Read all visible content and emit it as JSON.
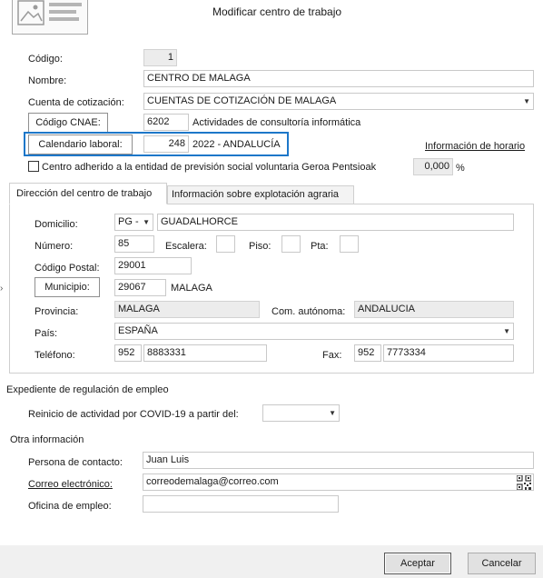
{
  "window": {
    "title": "Modificar centro de trabajo"
  },
  "main": {
    "codigo": {
      "label": "Código:",
      "value": "1"
    },
    "nombre": {
      "label": "Nombre:",
      "value": "CENTRO DE MALAGA"
    },
    "cuenta": {
      "label": "Cuenta de cotización:",
      "value": "CUENTAS DE COTIZACIÓN DE MALAGA"
    },
    "cnae": {
      "button": "Código CNAE:",
      "code": "6202",
      "description": "Actividades de consultoría informática"
    },
    "calendario": {
      "button": "Calendario laboral:",
      "code": "248",
      "description": "2022 - ANDALUCÍA"
    },
    "info_horario": "Información de horario",
    "geroa": {
      "label": "Centro adherido a la entidad de previsión social voluntaria Geroa Pentsioak",
      "value": "0,000",
      "unit": "%"
    }
  },
  "tabs": [
    {
      "label": "Dirección del centro de trabajo"
    },
    {
      "label": "Información sobre explotación agraria"
    }
  ],
  "direccion": {
    "domicilio": {
      "label": "Domicilio:",
      "type": "PG -",
      "value": "GUADALHORCE"
    },
    "numero": {
      "label": "Número:",
      "value": "85"
    },
    "escalera": {
      "label": "Escalera:",
      "value": ""
    },
    "piso": {
      "label": "Piso:",
      "value": ""
    },
    "pta": {
      "label": "Pta:",
      "value": ""
    },
    "codigo_postal": {
      "label": "Código Postal:",
      "value": "29001"
    },
    "municipio": {
      "button": "Municipio:",
      "code": "29067",
      "name": "MALAGA"
    },
    "provincia": {
      "label": "Provincia:",
      "value": "MALAGA"
    },
    "com_autonoma": {
      "label": "Com. autónoma:",
      "value": "ANDALUCIA"
    },
    "pais": {
      "label": "País:",
      "value": "ESPAÑA"
    },
    "telefono": {
      "label": "Teléfono:",
      "prefix": "952",
      "value": "8883331"
    },
    "fax": {
      "label": "Fax:",
      "prefix": "952",
      "value": "7773334"
    }
  },
  "erte": {
    "heading": "Expediente de regulación de empleo",
    "reinicio": {
      "label": "Reinicio de actividad por COVID-19 a partir del:",
      "value": ""
    }
  },
  "otra": {
    "heading": "Otra información",
    "contacto": {
      "label": "Persona de contacto:",
      "value": "Juan Luis"
    },
    "correo": {
      "label": "Correo electrónico:",
      "value": "correodemalaga@correo.com"
    },
    "oficina": {
      "label": "Oficina de empleo:",
      "value": ""
    }
  },
  "footer": {
    "accept": "Aceptar",
    "cancel": "Cancelar"
  },
  "colors": {
    "highlight": "#1d77c9",
    "footer_bg": "#f0f0f0",
    "readonly_bg": "#ececec"
  }
}
